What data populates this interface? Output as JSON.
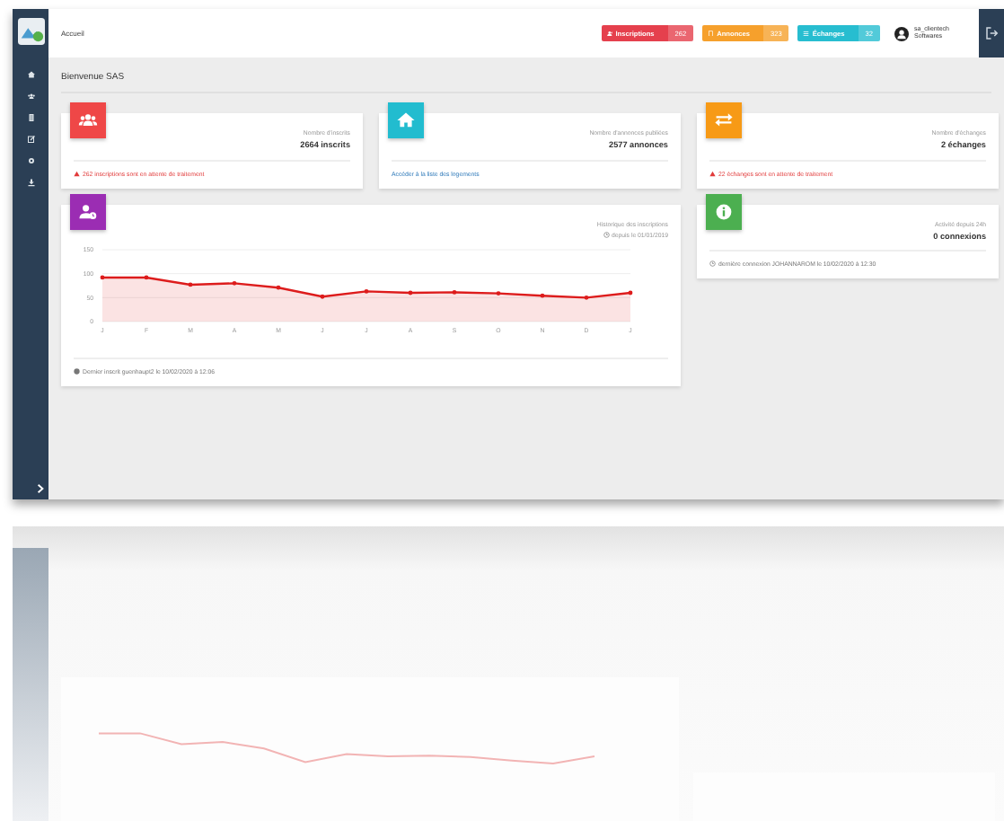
{
  "breadcrumb": "Accueil",
  "badges": [
    {
      "label": "Inscriptions",
      "count": "262",
      "color": "#e5404d"
    },
    {
      "label": "Annonces",
      "count": "323",
      "color": "#f6a02c"
    },
    {
      "label": "Échanges",
      "count": "32",
      "color": "#27bdd0"
    }
  ],
  "user": {
    "name": "sa_clientech",
    "subtitle": "Softwares"
  },
  "page_title": "Bienvenue SAS",
  "stat_cards": [
    {
      "kind": "warning",
      "color": "#ef4747",
      "caption": "Nombre d'inscrits",
      "value": "2664 inscrits",
      "footer": "262 inscriptions sont en attente de traitement"
    },
    {
      "kind": "link",
      "color": "#22bccf",
      "caption": "Nombre d'annonces publiées",
      "value": "2577 annonces",
      "footer": "Accéder à la liste des logements"
    },
    {
      "kind": "warning",
      "color": "#f79a16",
      "caption": "Nombre d'échanges",
      "value": "2 échanges",
      "footer": "22 échanges sont en attente de traitement"
    }
  ],
  "history_card": {
    "color": "#9b2db3",
    "title": "Historique des inscriptions",
    "since": "depuis le 01/01/2019",
    "footer": "Dernier inscrit guenhaupt2 le 10/02/2020 à 12:06",
    "chart_data": {
      "type": "area",
      "categories": [
        "J",
        "F",
        "M",
        "A",
        "M",
        "J",
        "J",
        "A",
        "S",
        "O",
        "N",
        "D",
        "J"
      ],
      "series": [
        {
          "color": "#dd1c1c",
          "values": [
            92,
            92,
            77,
            80,
            71,
            52,
            63,
            60,
            61,
            59,
            54,
            50,
            60
          ]
        }
      ],
      "ylim": [
        0,
        150
      ],
      "yticks": [
        0,
        50,
        100,
        150
      ]
    }
  },
  "activity_card": {
    "color": "#4caf50",
    "caption": "Activité depuis 24h",
    "value": "0 connexions",
    "footer": "dernière connexion JOHANNAROM le 10/02/2020 à 12:30"
  }
}
